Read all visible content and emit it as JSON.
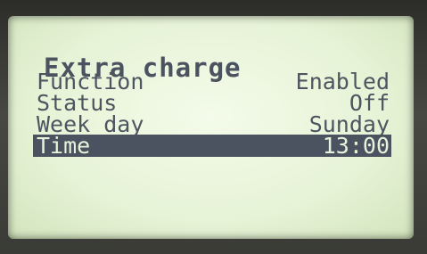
{
  "screen": {
    "title": "Extra charge"
  },
  "rows": [
    {
      "label": "Function",
      "value": "Enabled"
    },
    {
      "label": "Status",
      "value": "Off"
    },
    {
      "label": "Week day",
      "value": "Sunday"
    },
    {
      "label": "Time",
      "value": "13:00",
      "selected": true
    }
  ],
  "colors": {
    "lcd_background": "#e6f3d6",
    "pixel_text": "#4a535f",
    "bezel": "#3a3b36"
  }
}
